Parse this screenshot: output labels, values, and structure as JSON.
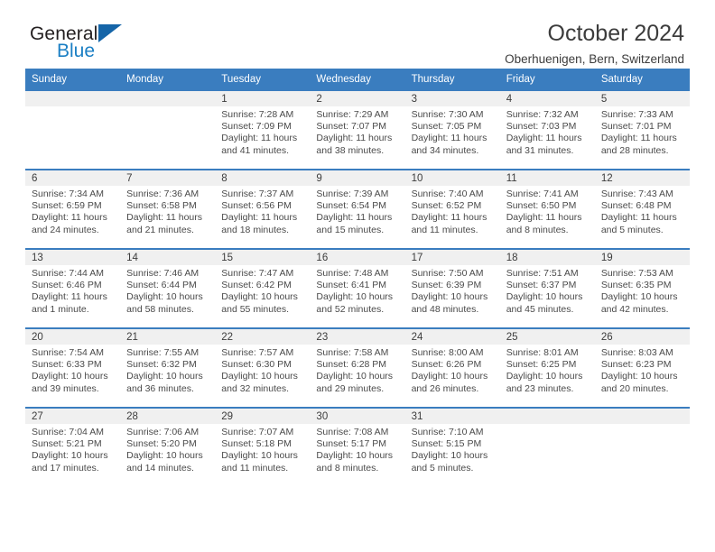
{
  "brand": {
    "word_top": "General",
    "word_bottom": "Blue",
    "triangle_icon": "blue-triangle-logo-icon",
    "color_dark": "#231f20",
    "color_blue": "#1b7fc4"
  },
  "header": {
    "title": "October 2024",
    "subtitle": "Oberhuenigen, Bern, Switzerland"
  },
  "theme": {
    "header_row_bg": "#3a7dbf",
    "header_row_text": "#ffffff",
    "daynum_band_bg": "#f0f0f0",
    "grid_line": "#3a7dbf",
    "body_text": "#4a4a4a"
  },
  "weekday_headers": [
    "Sunday",
    "Monday",
    "Tuesday",
    "Wednesday",
    "Thursday",
    "Friday",
    "Saturday"
  ],
  "labels": {
    "sunrise_prefix": "Sunrise:",
    "sunset_prefix": "Sunset:",
    "daylight_prefix": "Daylight:"
  },
  "weeks": [
    [
      {
        "day": "",
        "empty": true
      },
      {
        "day": "",
        "empty": true
      },
      {
        "day": "1",
        "sunrise": "Sunrise: 7:28 AM",
        "sunset": "Sunset: 7:09 PM",
        "daylight_1": "Daylight: 11 hours",
        "daylight_2": "and 41 minutes."
      },
      {
        "day": "2",
        "sunrise": "Sunrise: 7:29 AM",
        "sunset": "Sunset: 7:07 PM",
        "daylight_1": "Daylight: 11 hours",
        "daylight_2": "and 38 minutes."
      },
      {
        "day": "3",
        "sunrise": "Sunrise: 7:30 AM",
        "sunset": "Sunset: 7:05 PM",
        "daylight_1": "Daylight: 11 hours",
        "daylight_2": "and 34 minutes."
      },
      {
        "day": "4",
        "sunrise": "Sunrise: 7:32 AM",
        "sunset": "Sunset: 7:03 PM",
        "daylight_1": "Daylight: 11 hours",
        "daylight_2": "and 31 minutes."
      },
      {
        "day": "5",
        "sunrise": "Sunrise: 7:33 AM",
        "sunset": "Sunset: 7:01 PM",
        "daylight_1": "Daylight: 11 hours",
        "daylight_2": "and 28 minutes."
      }
    ],
    [
      {
        "day": "6",
        "sunrise": "Sunrise: 7:34 AM",
        "sunset": "Sunset: 6:59 PM",
        "daylight_1": "Daylight: 11 hours",
        "daylight_2": "and 24 minutes."
      },
      {
        "day": "7",
        "sunrise": "Sunrise: 7:36 AM",
        "sunset": "Sunset: 6:58 PM",
        "daylight_1": "Daylight: 11 hours",
        "daylight_2": "and 21 minutes."
      },
      {
        "day": "8",
        "sunrise": "Sunrise: 7:37 AM",
        "sunset": "Sunset: 6:56 PM",
        "daylight_1": "Daylight: 11 hours",
        "daylight_2": "and 18 minutes."
      },
      {
        "day": "9",
        "sunrise": "Sunrise: 7:39 AM",
        "sunset": "Sunset: 6:54 PM",
        "daylight_1": "Daylight: 11 hours",
        "daylight_2": "and 15 minutes."
      },
      {
        "day": "10",
        "sunrise": "Sunrise: 7:40 AM",
        "sunset": "Sunset: 6:52 PM",
        "daylight_1": "Daylight: 11 hours",
        "daylight_2": "and 11 minutes."
      },
      {
        "day": "11",
        "sunrise": "Sunrise: 7:41 AM",
        "sunset": "Sunset: 6:50 PM",
        "daylight_1": "Daylight: 11 hours",
        "daylight_2": "and 8 minutes."
      },
      {
        "day": "12",
        "sunrise": "Sunrise: 7:43 AM",
        "sunset": "Sunset: 6:48 PM",
        "daylight_1": "Daylight: 11 hours",
        "daylight_2": "and 5 minutes."
      }
    ],
    [
      {
        "day": "13",
        "sunrise": "Sunrise: 7:44 AM",
        "sunset": "Sunset: 6:46 PM",
        "daylight_1": "Daylight: 11 hours",
        "daylight_2": "and 1 minute."
      },
      {
        "day": "14",
        "sunrise": "Sunrise: 7:46 AM",
        "sunset": "Sunset: 6:44 PM",
        "daylight_1": "Daylight: 10 hours",
        "daylight_2": "and 58 minutes."
      },
      {
        "day": "15",
        "sunrise": "Sunrise: 7:47 AM",
        "sunset": "Sunset: 6:42 PM",
        "daylight_1": "Daylight: 10 hours",
        "daylight_2": "and 55 minutes."
      },
      {
        "day": "16",
        "sunrise": "Sunrise: 7:48 AM",
        "sunset": "Sunset: 6:41 PM",
        "daylight_1": "Daylight: 10 hours",
        "daylight_2": "and 52 minutes."
      },
      {
        "day": "17",
        "sunrise": "Sunrise: 7:50 AM",
        "sunset": "Sunset: 6:39 PM",
        "daylight_1": "Daylight: 10 hours",
        "daylight_2": "and 48 minutes."
      },
      {
        "day": "18",
        "sunrise": "Sunrise: 7:51 AM",
        "sunset": "Sunset: 6:37 PM",
        "daylight_1": "Daylight: 10 hours",
        "daylight_2": "and 45 minutes."
      },
      {
        "day": "19",
        "sunrise": "Sunrise: 7:53 AM",
        "sunset": "Sunset: 6:35 PM",
        "daylight_1": "Daylight: 10 hours",
        "daylight_2": "and 42 minutes."
      }
    ],
    [
      {
        "day": "20",
        "sunrise": "Sunrise: 7:54 AM",
        "sunset": "Sunset: 6:33 PM",
        "daylight_1": "Daylight: 10 hours",
        "daylight_2": "and 39 minutes."
      },
      {
        "day": "21",
        "sunrise": "Sunrise: 7:55 AM",
        "sunset": "Sunset: 6:32 PM",
        "daylight_1": "Daylight: 10 hours",
        "daylight_2": "and 36 minutes."
      },
      {
        "day": "22",
        "sunrise": "Sunrise: 7:57 AM",
        "sunset": "Sunset: 6:30 PM",
        "daylight_1": "Daylight: 10 hours",
        "daylight_2": "and 32 minutes."
      },
      {
        "day": "23",
        "sunrise": "Sunrise: 7:58 AM",
        "sunset": "Sunset: 6:28 PM",
        "daylight_1": "Daylight: 10 hours",
        "daylight_2": "and 29 minutes."
      },
      {
        "day": "24",
        "sunrise": "Sunrise: 8:00 AM",
        "sunset": "Sunset: 6:26 PM",
        "daylight_1": "Daylight: 10 hours",
        "daylight_2": "and 26 minutes."
      },
      {
        "day": "25",
        "sunrise": "Sunrise: 8:01 AM",
        "sunset": "Sunset: 6:25 PM",
        "daylight_1": "Daylight: 10 hours",
        "daylight_2": "and 23 minutes."
      },
      {
        "day": "26",
        "sunrise": "Sunrise: 8:03 AM",
        "sunset": "Sunset: 6:23 PM",
        "daylight_1": "Daylight: 10 hours",
        "daylight_2": "and 20 minutes."
      }
    ],
    [
      {
        "day": "27",
        "sunrise": "Sunrise: 7:04 AM",
        "sunset": "Sunset: 5:21 PM",
        "daylight_1": "Daylight: 10 hours",
        "daylight_2": "and 17 minutes."
      },
      {
        "day": "28",
        "sunrise": "Sunrise: 7:06 AM",
        "sunset": "Sunset: 5:20 PM",
        "daylight_1": "Daylight: 10 hours",
        "daylight_2": "and 14 minutes."
      },
      {
        "day": "29",
        "sunrise": "Sunrise: 7:07 AM",
        "sunset": "Sunset: 5:18 PM",
        "daylight_1": "Daylight: 10 hours",
        "daylight_2": "and 11 minutes."
      },
      {
        "day": "30",
        "sunrise": "Sunrise: 7:08 AM",
        "sunset": "Sunset: 5:17 PM",
        "daylight_1": "Daylight: 10 hours",
        "daylight_2": "and 8 minutes."
      },
      {
        "day": "31",
        "sunrise": "Sunrise: 7:10 AM",
        "sunset": "Sunset: 5:15 PM",
        "daylight_1": "Daylight: 10 hours",
        "daylight_2": "and 5 minutes."
      },
      {
        "day": "",
        "empty": true
      },
      {
        "day": "",
        "empty": true
      }
    ]
  ]
}
